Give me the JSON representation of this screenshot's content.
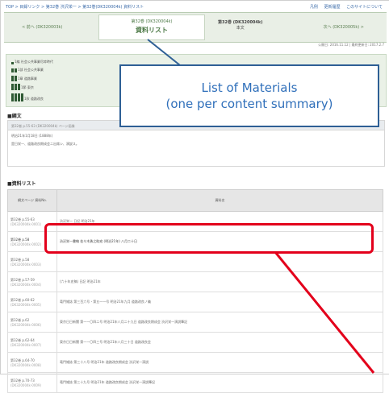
{
  "breadcrumb": [
    "TOP",
    "目録リンク",
    "第32巻 渋沢栄一",
    "第32巻(DK320004k) 資料リスト"
  ],
  "top_links": [
    "凡例",
    "更新履歴",
    "このサイトについて"
  ],
  "volume_nav": {
    "prev_label": "< 前へ (DK320003k)",
    "current_sub": "第32巻 (DK320004k)",
    "current_label": "資料リスト",
    "mid_title": "第32巻 (DK320004k)",
    "mid_sub": "本文",
    "next_label": "次へ (DK320005k) >"
  },
  "dates": "公開日: 2016.11.12 | 最終更新日: 2017.2.7",
  "tree_rows": [
    "1編 社会公共事業尽瘁時代",
    "1部 社会公共事業",
    "1章 道路事業",
    "1節 東京",
    "1款 道路改良"
  ],
  "sections": {
    "text": "■綱文",
    "list": "■資料リスト"
  },
  "text_header": "第32巻 p.55-63 (DK320004k) ページ画像",
  "text_lines": [
    "明治21年1月18日 (1888年)",
    "是日栄一、道路改良期成会ニ出席シ、演説ス。"
  ],
  "table_headers": [
    "綱文ページ 資料No.",
    "資料名"
  ],
  "table_rows": [
    {
      "page": "第32巻 p.55-63",
      "id": "(DK320004k-0001)",
      "title": "渋沢栄一 日記 明治21年"
    },
    {
      "page": "第32巻 p.58",
      "id": "(DK320004k-0002)",
      "title": "渋沢栄一書翰 佐々木勇之助宛 (明治21年) 八月二十日"
    },
    {
      "page": "第32巻 p.58",
      "id": "(DK320004k-0003)",
      "title": ""
    },
    {
      "page": "第32巻 p.57-59",
      "id": "(DK320004k-0004)",
      "title": "(六十年史稿) 日記 明治21年"
    },
    {
      "page": "第32巻 p.60-62",
      "id": "(DK320004k-0005)",
      "title": "竜門雑誌 第三百六号・第五一一号 明治21年九月 道路改良ノ儀"
    },
    {
      "page": "第32巻 p.62",
      "id": "(DK320004k-0006)",
      "title": "東京日日新聞 第一一〇四二号 明治21年八月二十九日 道路改良期成会 渋沢栄一演説筆記"
    },
    {
      "page": "第32巻 p.62-64",
      "id": "(DK320004k-0007)",
      "title": "東京日日新聞 第一一〇四三号 明治21年八月三十日 道路改良会"
    },
    {
      "page": "第32巻 p.64-70",
      "id": "(DK320004k-0008)",
      "title": "竜門雑誌 第三十八号 明治21年 道路改良期成会 渋沢栄一演説"
    },
    {
      "page": "第32巻 p.70-73",
      "id": "(DK320004k-0009)",
      "title": "竜門雑誌 第三十九号 明治21年 道路改良期成会 渋沢栄一演説筆記"
    }
  ],
  "callout": {
    "line1": "List of Materials",
    "line2": "(one per content summary)",
    "border_color": "#2e5f95",
    "text_color": "#2f6fba"
  },
  "highlight_color": "#e3001b"
}
